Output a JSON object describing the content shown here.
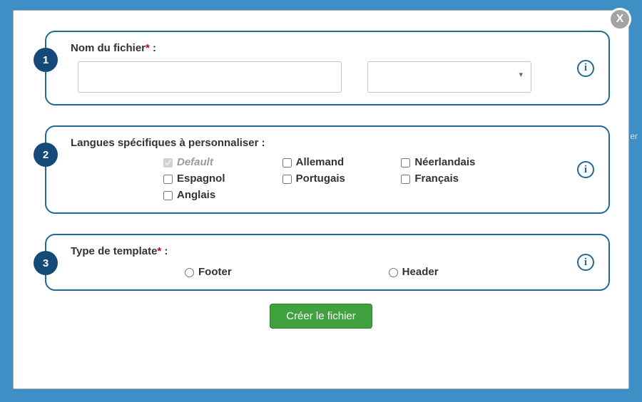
{
  "close_label": "X",
  "bg_hint": "er",
  "steps": {
    "s1": {
      "num": "1",
      "title_prefix": "Nom du fichier",
      "title_suffix": " :"
    },
    "s2": {
      "num": "2",
      "title": "Langues spécifiques à personnaliser :",
      "langs": {
        "default": "Default",
        "espagnol": "Espagnol",
        "anglais": "Anglais",
        "allemand": "Allemand",
        "portugais": "Portugais",
        "neerlandais": "Néerlandais",
        "francais": "Français"
      }
    },
    "s3": {
      "num": "3",
      "title_prefix": "Type de template",
      "title_suffix": " :",
      "footer": "Footer",
      "header": "Header"
    }
  },
  "required_mark": "*",
  "info_glyph": "i",
  "create_label": "Créer le fichier"
}
